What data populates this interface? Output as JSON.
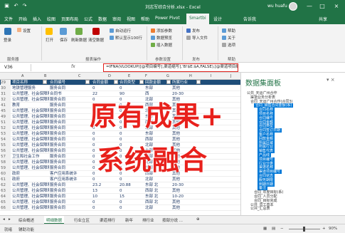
{
  "titlebar": {
    "save_icon": "save-icon",
    "undo_icon": "undo-icon",
    "redo_icon": "redo-icon",
    "title": "刘志军综合分析.xlsx - Excel",
    "user": "wu huafu",
    "minimize": "—",
    "maximize": "□",
    "close": "×"
  },
  "tabs": [
    "文件",
    "开始",
    "插入",
    "绘图",
    "页面布局",
    "公式",
    "数据",
    "审阅",
    "视图",
    "帮助",
    "Power Pivot",
    "Smartbi",
    "设计",
    "告诉我",
    "共享"
  ],
  "active_tab": "Smartbi",
  "ribbon": {
    "btn_1": "登录",
    "btn_2": "设置",
    "btn_3": "打开",
    "btn_4": "保存",
    "btn_5": "刷新数据",
    "btn_6": "清空数据",
    "btn_7": "自动运行",
    "btn_8": "默认显示100行",
    "btn_9": "添加参数",
    "btn_10": "数据预览",
    "btn_11": "插入数据",
    "btn_12": "发布",
    "btn_13": "导入文件",
    "btn_14": "帮助",
    "btn_15": "关于",
    "btn_16": "选项",
    "group_1": "服务器",
    "group_2": "报表操作",
    "group_3": "参数设置",
    "group_4": "发布",
    "group_5": "帮助"
  },
  "formula_bar": {
    "name_box": "V36",
    "fx": "fx",
    "formula": "=IFNA(VLOOKUP([@项目编号],渠道缩写],'B!$E:$A,FALSE),[@渠道项目编号])"
  },
  "columns": [
    "A",
    "B",
    "C",
    "D",
    "E",
    "F",
    "G",
    "H",
    "I",
    "J"
  ],
  "table_header": [
    "项目名称",
    "合同编号",
    "合同金额",
    "合同类型",
    "回款金额",
    "所属行业"
  ],
  "rows": [
    {
      "rn": "30",
      "cells": [
        "地铁管理服务",
        "服务合同",
        "0",
        "0",
        "东部",
        "其他"
      ]
    },
    {
      "rn": "31",
      "cells": [
        "公共管理、社会保障和社",
        "合同书",
        "22",
        "90",
        "西",
        "20-30"
      ]
    },
    {
      "rn": "32",
      "cells": [
        "公共管理、社会保障和社",
        "服务合同",
        "0",
        "0",
        "北部",
        "其他"
      ]
    },
    {
      "rn": "41",
      "cells": [
        "教育",
        "服务合同",
        "10",
        "0",
        "西部",
        "其他"
      ]
    },
    {
      "rn": "45",
      "cells": [
        "公共管理、社会保障和社",
        "服务合同",
        "0",
        "0",
        "北部",
        "其他"
      ]
    },
    {
      "rn": "49",
      "cells": [
        "公共管理、社会保障和社",
        "服务合同",
        "0",
        "0",
        "东部",
        "其他"
      ]
    },
    {
      "rn": "51",
      "cells": [
        "公共管理、社会保障和社",
        "服务合同",
        "0",
        "0",
        "西部",
        "其他"
      ]
    },
    {
      "rn": "52",
      "cells": [
        "公共管理、社会保障和社",
        "服务合同",
        "0",
        "0",
        "北部",
        "其他"
      ]
    },
    {
      "rn": "53",
      "cells": [
        "公共管理、社会保障和社",
        "服务合同",
        "0",
        "0",
        "东部",
        "其他"
      ]
    },
    {
      "rn": "54",
      "cells": [
        "公共管理、社会保障和社",
        "服务合同",
        "0",
        "0",
        "西部",
        "其他"
      ]
    },
    {
      "rn": "55",
      "cells": [
        "公共管理、社会保障和社",
        "服务合同",
        "0",
        "0",
        "北部",
        "其他"
      ]
    },
    {
      "rn": "56",
      "cells": [
        "公共管理、社会保障和社",
        "服务合同",
        "0",
        "0",
        "东部",
        "其他"
      ]
    },
    {
      "rn": "57",
      "cells": [
        "卫生和社会工作",
        "服务合同",
        "0",
        "0",
        "西部",
        "其他"
      ]
    },
    {
      "rn": "58",
      "cells": [
        "公共管理、社会保障和社",
        "服务合同",
        "0",
        "0",
        "北部",
        "其他"
      ]
    },
    {
      "rn": "59",
      "cells": [
        "公共管理、社会保障和社",
        "服务合同",
        "0",
        "0",
        "东部",
        "其他"
      ]
    },
    {
      "rn": "60",
      "cells": [
        "政府",
        "客户应用系统许",
        "0",
        "0",
        "西部",
        "其他"
      ]
    },
    {
      "rn": "61",
      "cells": [
        "政府",
        "客户应用系统许",
        "0",
        "0",
        "北部",
        "其他"
      ]
    },
    {
      "rn": "62",
      "cells": [
        "公共管理、社会保障和社",
        "服务合同",
        "23.2",
        "20.88",
        "东部 北",
        "20-30"
      ]
    },
    {
      "rn": "63",
      "cells": [
        "公共管理、社会保障和社",
        "服务合同",
        "13",
        "0",
        "西部 北",
        "其他"
      ]
    },
    {
      "rn": "64",
      "cells": [
        "公共管理、社会保障和社",
        "服务合同",
        "10",
        "15",
        "东部 北",
        "10-20"
      ]
    },
    {
      "rn": "65",
      "cells": [
        "公共管理、社会保障和社",
        "服务合同",
        "0",
        "0",
        "西部 北",
        "其他"
      ]
    },
    {
      "rn": "66",
      "cells": [
        "公共管理、社会保障和社",
        "服务合同",
        "0",
        "0",
        "北部",
        "其他"
      ]
    }
  ],
  "overlay": {
    "line1": "原有成果+",
    "line2": "系统融合"
  },
  "panel": {
    "title": "数据集面板",
    "tree": [
      {
        "label": "公共_天运广州合作",
        "level": 0,
        "selected": false
      },
      {
        "label": "渠道业务分析表",
        "level": 1,
        "selected": false
      },
      {
        "label": "合同_天运广州合作(合同3)",
        "level": 1,
        "selected": false
      },
      {
        "label": "合同_销售合同金额(系)",
        "level": 2,
        "selected": true
      },
      {
        "label": "合同名称",
        "level": 3,
        "selected": true
      },
      {
        "label": "项目名称",
        "level": 3,
        "selected": true
      },
      {
        "label": "合同编号",
        "level": 3,
        "selected": true
      },
      {
        "label": "合同金额",
        "level": 3,
        "selected": true
      },
      {
        "label": "合同类型",
        "level": 3,
        "selected": true
      },
      {
        "label": "合同签订日期",
        "level": 3,
        "selected": true
      },
      {
        "label": "客户名称",
        "level": 3,
        "selected": true
      },
      {
        "label": "回款金额",
        "level": 3,
        "selected": true
      },
      {
        "label": "所属区域",
        "level": 3,
        "selected": true
      },
      {
        "label": "所属行业",
        "level": 3,
        "selected": true
      },
      {
        "label": "销售代表",
        "level": 3,
        "selected": true
      },
      {
        "label": "产品线",
        "level": 3,
        "selected": true
      },
      {
        "label": "项目编号",
        "level": 3,
        "selected": true
      },
      {
        "label": "行业分类",
        "level": 3,
        "selected": true
      },
      {
        "label": "渠道名称",
        "level": 3,
        "selected": true
      },
      {
        "label": "渠道项目编号",
        "level": 3,
        "selected": true
      },
      {
        "label": "合同状态",
        "level": 3,
        "selected": true
      },
      {
        "label": "服务期限",
        "level": 3,
        "selected": true
      },
      {
        "label": "到期日期",
        "level": 3,
        "selected": true
      },
      {
        "label": "备注",
        "level": 3,
        "selected": true
      },
      {
        "label": "合同_年度目标(系)",
        "level": 2,
        "selected": false
      },
      {
        "label": "合同_人员分配",
        "level": 2,
        "selected": false
      },
      {
        "label": "合同_目标完成",
        "level": 2,
        "selected": false
      },
      {
        "label": "公共_员工基本",
        "level": 1,
        "selected": false
      },
      {
        "label": "公共_汇总表",
        "level": 1,
        "selected": false
      }
    ]
  },
  "sheet_tabs": [
    "综合概述",
    "明细数据",
    "行业立区",
    "渠道排行",
    "新年",
    "排行业",
    "按部分说 ..."
  ],
  "active_sheet": "明细数据",
  "status": {
    "ready": "就绪",
    "mode": "辅助功能",
    "zoom": "90%"
  }
}
